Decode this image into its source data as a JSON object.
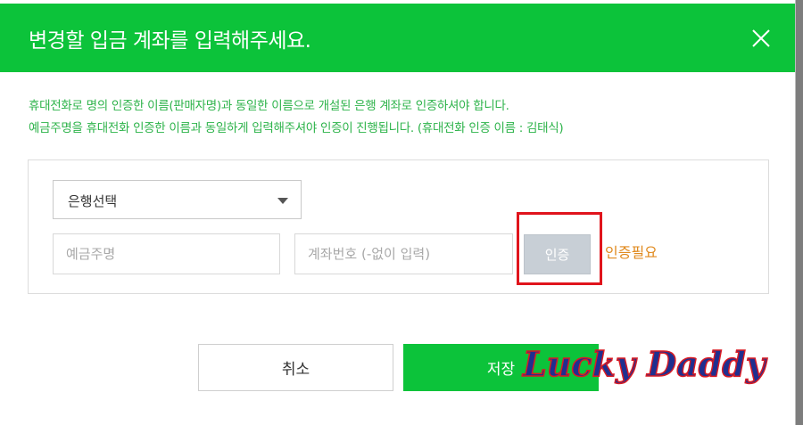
{
  "dialog": {
    "title": "변경할 입금 계좌를 입력해주세요.",
    "notice_line1": "휴대전화로 명의 인증한 이름(판매자명)과 동일한 이름으로 개설된 은행 계좌로 인증하셔야 합니다.",
    "notice_line2": "예금주명을 휴대전화 인증한 이름과 동일하게 입력해주셔야 인증이 진행됩니다. (휴대전화 인증 이름 : 김태식)"
  },
  "form": {
    "bank_select_label": "은행선택",
    "holder_placeholder": "예금주명",
    "account_placeholder": "계좌번호 (-없이 입력)",
    "verify_label": "인증",
    "status_text": "인증필요"
  },
  "footer": {
    "cancel_label": "취소",
    "save_label": "저장"
  },
  "watermark": {
    "text": "Lucky Daddy"
  },
  "colors": {
    "brand_green": "#0cc33a",
    "notice_green": "#2db34a",
    "status_orange": "#e08a1e",
    "highlight_red": "#e0141c",
    "disabled_button": "#c8cfd6"
  },
  "icons": {
    "close": "close-icon",
    "dropdown": "chevron-down-icon"
  }
}
